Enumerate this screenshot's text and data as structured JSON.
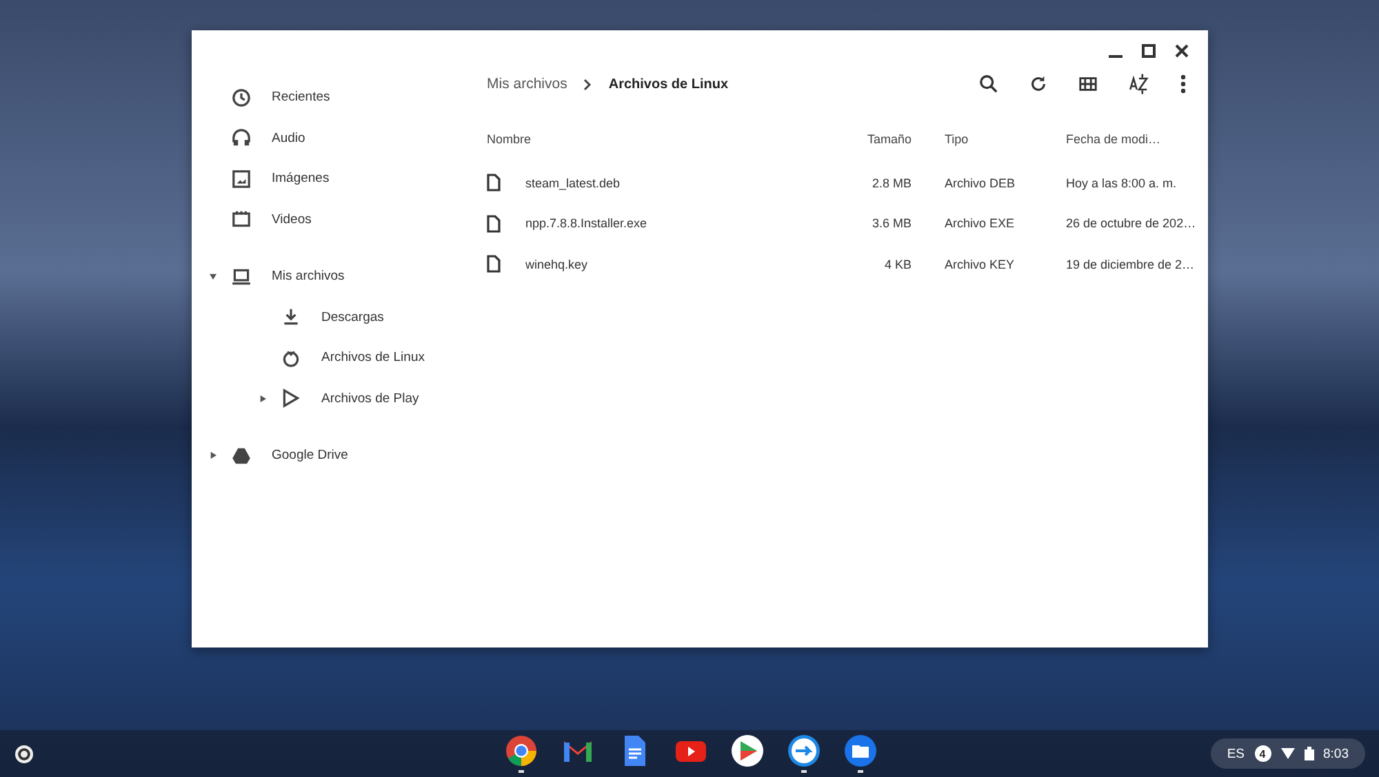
{
  "sidebar": {
    "items": [
      {
        "label": "Recientes"
      },
      {
        "label": "Audio"
      },
      {
        "label": "Imágenes"
      },
      {
        "label": "Videos"
      },
      {
        "label": "Mis archivos",
        "expanded": true,
        "children": [
          {
            "label": "Descargas"
          },
          {
            "label": "Archivos de Linux"
          },
          {
            "label": "Archivos de Play",
            "expanded": false
          }
        ]
      },
      {
        "label": "Google Drive",
        "expanded": false
      }
    ]
  },
  "breadcrumb": [
    "Mis archivos",
    "Archivos de Linux"
  ],
  "table": {
    "columns": [
      "Nombre",
      "Tamaño",
      "Tipo",
      "Fecha de modi…"
    ],
    "rows": [
      [
        "steam_latest.deb",
        "2.8 MB",
        "Archivo DEB",
        "Hoy a las 8:00 a. m."
      ],
      [
        "npp.7.8.8.Installer.exe",
        "3.6 MB",
        "Archivo EXE",
        "26 de octubre de 202…"
      ],
      [
        "winehq.key",
        "4 KB",
        "Archivo KEY",
        "19 de diciembre de 2…"
      ]
    ]
  },
  "shelf": {
    "apps": [
      {
        "running": true
      },
      {
        "running": false
      },
      {
        "running": false
      },
      {
        "running": false
      },
      {
        "running": false
      },
      {
        "running": true
      },
      {
        "running": true
      }
    ],
    "status": {
      "ime": "ES",
      "notifications": "4",
      "time": "8:03"
    }
  }
}
